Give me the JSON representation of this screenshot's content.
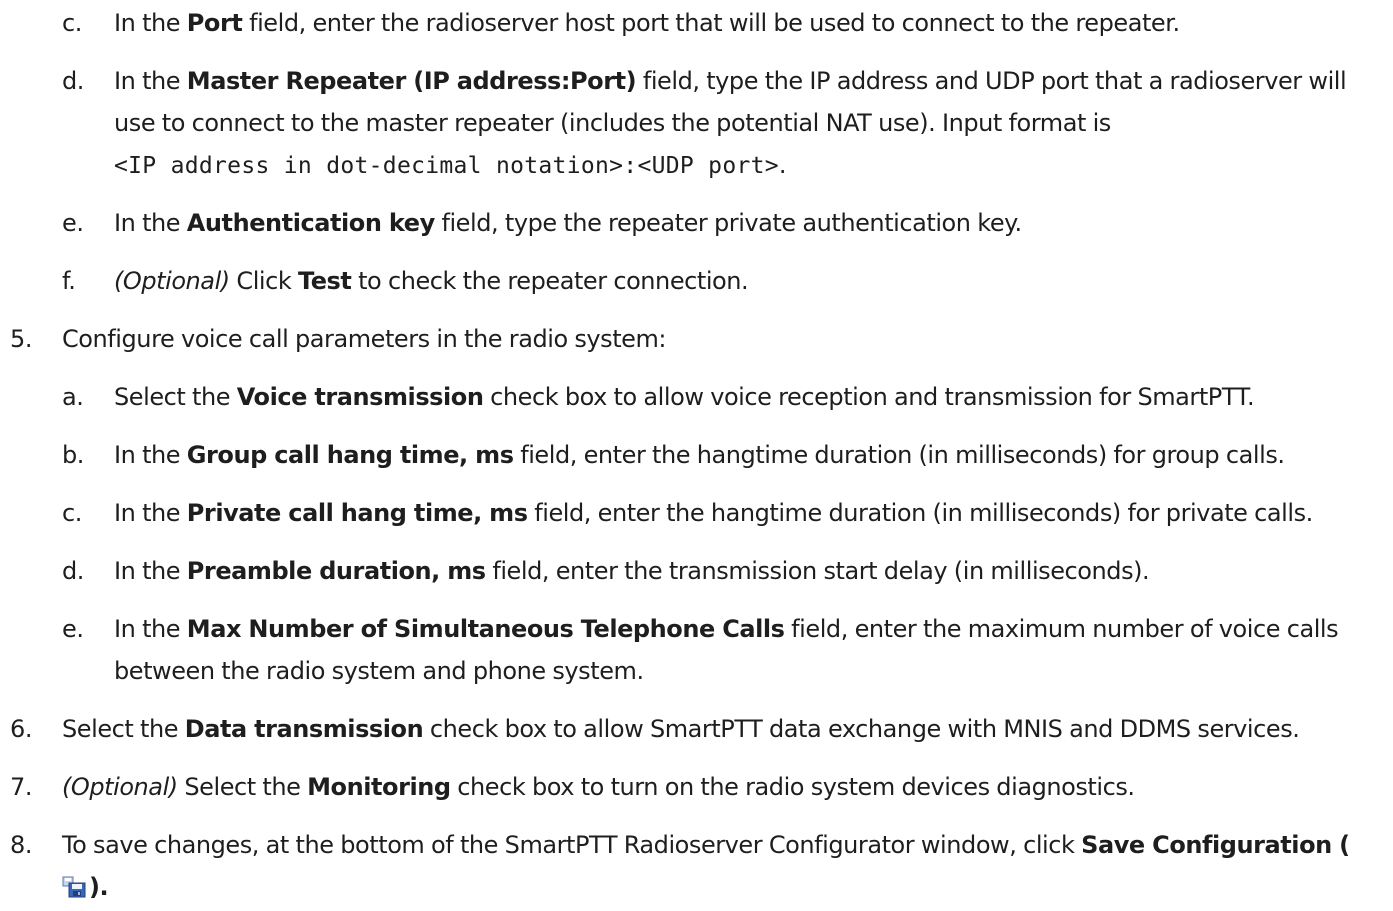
{
  "substeps_4": [
    {
      "marker": "c.",
      "pre": "In the ",
      "bold": "Port",
      "post": " field, enter the radioserver host port that will be used to connect to the repeater."
    },
    {
      "marker": "d.",
      "pre": "In the ",
      "bold": "Master Repeater (IP address:Port)",
      "post": " field, type the IP address and UDP port that a radioserver will use to connect to the master repeater (includes the potential NAT use). Input format is",
      "code": "<IP address in dot-decimal notation>:<UDP port>",
      "code_post": "."
    },
    {
      "marker": "e.",
      "pre": "In the ",
      "bold": "Authentication key",
      "post": " field, type the repeater private authentication key."
    },
    {
      "marker": "f.",
      "italic": "(Optional)",
      "pre": " Click ",
      "bold": "Test",
      "post": " to check the repeater connection."
    }
  ],
  "step5": {
    "marker": "5.",
    "text": "Configure voice call parameters in the radio system:",
    "substeps": [
      {
        "marker": "a.",
        "pre": "Select the ",
        "bold": "Voice transmission",
        "post": " check box to allow voice reception and transmission for SmartPTT."
      },
      {
        "marker": "b.",
        "pre": "In the ",
        "bold": "Group call hang time, ms",
        "post": " field, enter the hangtime duration (in milliseconds) for group calls."
      },
      {
        "marker": "c.",
        "pre": "In the ",
        "bold": "Private call hang time, ms",
        "post": " field, enter the hangtime duration (in milliseconds) for private calls."
      },
      {
        "marker": "d.",
        "pre": "In the ",
        "bold": "Preamble duration, ms",
        "post": " field, enter the transmission start delay (in milliseconds)."
      },
      {
        "marker": "e.",
        "pre": "In the ",
        "bold": "Max Number of Simultaneous Telephone Calls",
        "post": " field, enter the maximum number of voice calls between the radio system and phone system."
      }
    ]
  },
  "step6": {
    "marker": "6.",
    "pre": "Select the ",
    "bold": "Data transmission",
    "post": " check box to allow SmartPTT data exchange with MNIS and DDMS services."
  },
  "step7": {
    "marker": "7.",
    "italic": "(Optional)",
    "pre": " Select the ",
    "bold": "Monitoring",
    "post": " check box to turn on the radio system devices diagnostics."
  },
  "step8": {
    "marker": "8.",
    "pre": "To save changes, at the bottom of the SmartPTT Radioserver Configurator window, click ",
    "bold": "Save Configuration (",
    "icon": "save-configuration-icon",
    "post": ")."
  }
}
